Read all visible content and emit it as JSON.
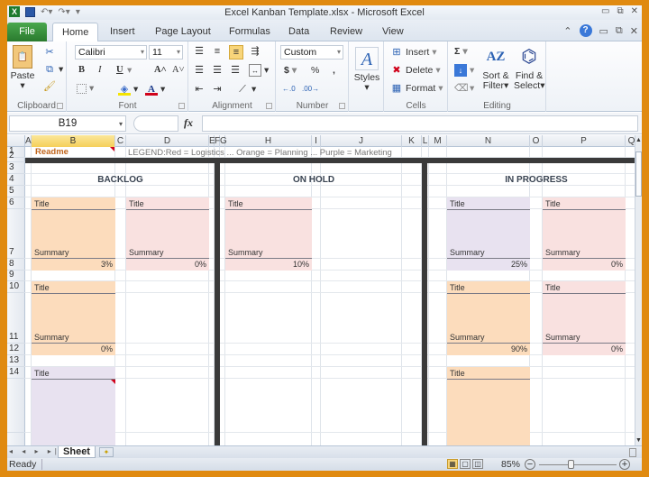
{
  "window": {
    "title": "Excel Kanban Template.xlsx - Microsoft Excel",
    "app_icon": "X",
    "qat": {
      "save": "save-icon",
      "undo": "undo-icon",
      "redo": "redo-icon",
      "customize": "▾"
    },
    "controls": {
      "minimize": "▭",
      "restore": "⧉",
      "close": "✕"
    }
  },
  "tabs": [
    "File",
    "Home",
    "Insert",
    "Page Layout",
    "Formulas",
    "Data",
    "Review",
    "View"
  ],
  "active_tab": "Home",
  "tab_right": {
    "collapse": "⌃",
    "help": "?",
    "minimize": "▭",
    "restore": "⧉",
    "close": "✕"
  },
  "ribbon": {
    "clipboard": {
      "label": "Clipboard",
      "paste": "Paste",
      "paste_arrow": "▾"
    },
    "font": {
      "label": "Font",
      "name": "Calibri",
      "size": "11",
      "bold": "B",
      "italic": "I",
      "underline": "U",
      "grow": "A˄",
      "shrink": "A˅",
      "fill_color": "#f5e400",
      "font_color": "#d0021b"
    },
    "alignment": {
      "label": "Alignment"
    },
    "number": {
      "label": "Number",
      "format": "Custom",
      "currency": "$",
      "percent": "%",
      "comma": ",",
      "inc_dec": "←.0 .00",
      "dec_dec": ".00 →.0"
    },
    "styles": {
      "label": "Styles"
    },
    "cells": {
      "label": "Cells",
      "insert": "Insert",
      "delete": "Delete",
      "format": "Format"
    },
    "editing": {
      "label": "Editing",
      "sum": "Σ",
      "sort": "Sort &",
      "sort2": "Filter",
      "find": "Find &",
      "find2": "Select"
    }
  },
  "formula_bar": {
    "name_box": "B19",
    "fx": "fx",
    "formula": ""
  },
  "columns": [
    "A",
    "B",
    "C",
    "D",
    "E",
    "F",
    "G",
    "H",
    "I",
    "J",
    "K",
    "L",
    "M",
    "N",
    "O",
    "P",
    "Q"
  ],
  "selected_column": "B",
  "rows": [
    "1",
    "2",
    "3",
    "4",
    "5",
    "6",
    "7",
    "8",
    "9",
    "10",
    "11",
    "12",
    "13",
    "14"
  ],
  "sheet": {
    "readme": "Readme",
    "legend": "LEGEND:Red = Logistics ... Orange = Planning ... Purple = Marketing",
    "columns": [
      {
        "title": "BACKLOG"
      },
      {
        "title": "ON HOLD"
      },
      {
        "title": "IN PROGRESS"
      }
    ],
    "colors": {
      "orange": "#fcdcbc",
      "red": "#f9e1e0",
      "purple": "#e8e2f0",
      "divider": "#3a3a3a",
      "readme": "#c0651c"
    },
    "cards": [
      {
        "id": "backlog-1",
        "title": "Title",
        "summary": "Summary",
        "progress": "3%",
        "color": "orange"
      },
      {
        "id": "backlog-2",
        "title": "Title",
        "summary": "Summary",
        "progress": "0%",
        "color": "red"
      },
      {
        "id": "backlog-3",
        "title": "Title",
        "summary": "Summary",
        "progress": "0%",
        "color": "orange"
      },
      {
        "id": "backlog-4",
        "title": "Title",
        "summary": "",
        "progress": "",
        "color": "purple"
      },
      {
        "id": "onhold-1",
        "title": "Title",
        "summary": "Summary",
        "progress": "10%",
        "color": "red"
      },
      {
        "id": "inprogress-1",
        "title": "Title",
        "summary": "Summary",
        "progress": "25%",
        "color": "purple"
      },
      {
        "id": "inprogress-2",
        "title": "Title",
        "summary": "Summary",
        "progress": "0%",
        "color": "red"
      },
      {
        "id": "inprogress-3",
        "title": "Title",
        "summary": "Summary",
        "progress": "90%",
        "color": "orange"
      },
      {
        "id": "inprogress-4",
        "title": "Title",
        "summary": "Summary",
        "progress": "0%",
        "color": "red"
      },
      {
        "id": "inprogress-5",
        "title": "Title",
        "summary": "",
        "progress": "",
        "color": "orange"
      }
    ]
  },
  "sheet_tabs": {
    "active": "Sheet",
    "nav": "◂ ◂ ▸ ▸|"
  },
  "status": {
    "ready": "Ready",
    "zoom": "85%",
    "zoom_minus": "−",
    "zoom_plus": "+"
  }
}
